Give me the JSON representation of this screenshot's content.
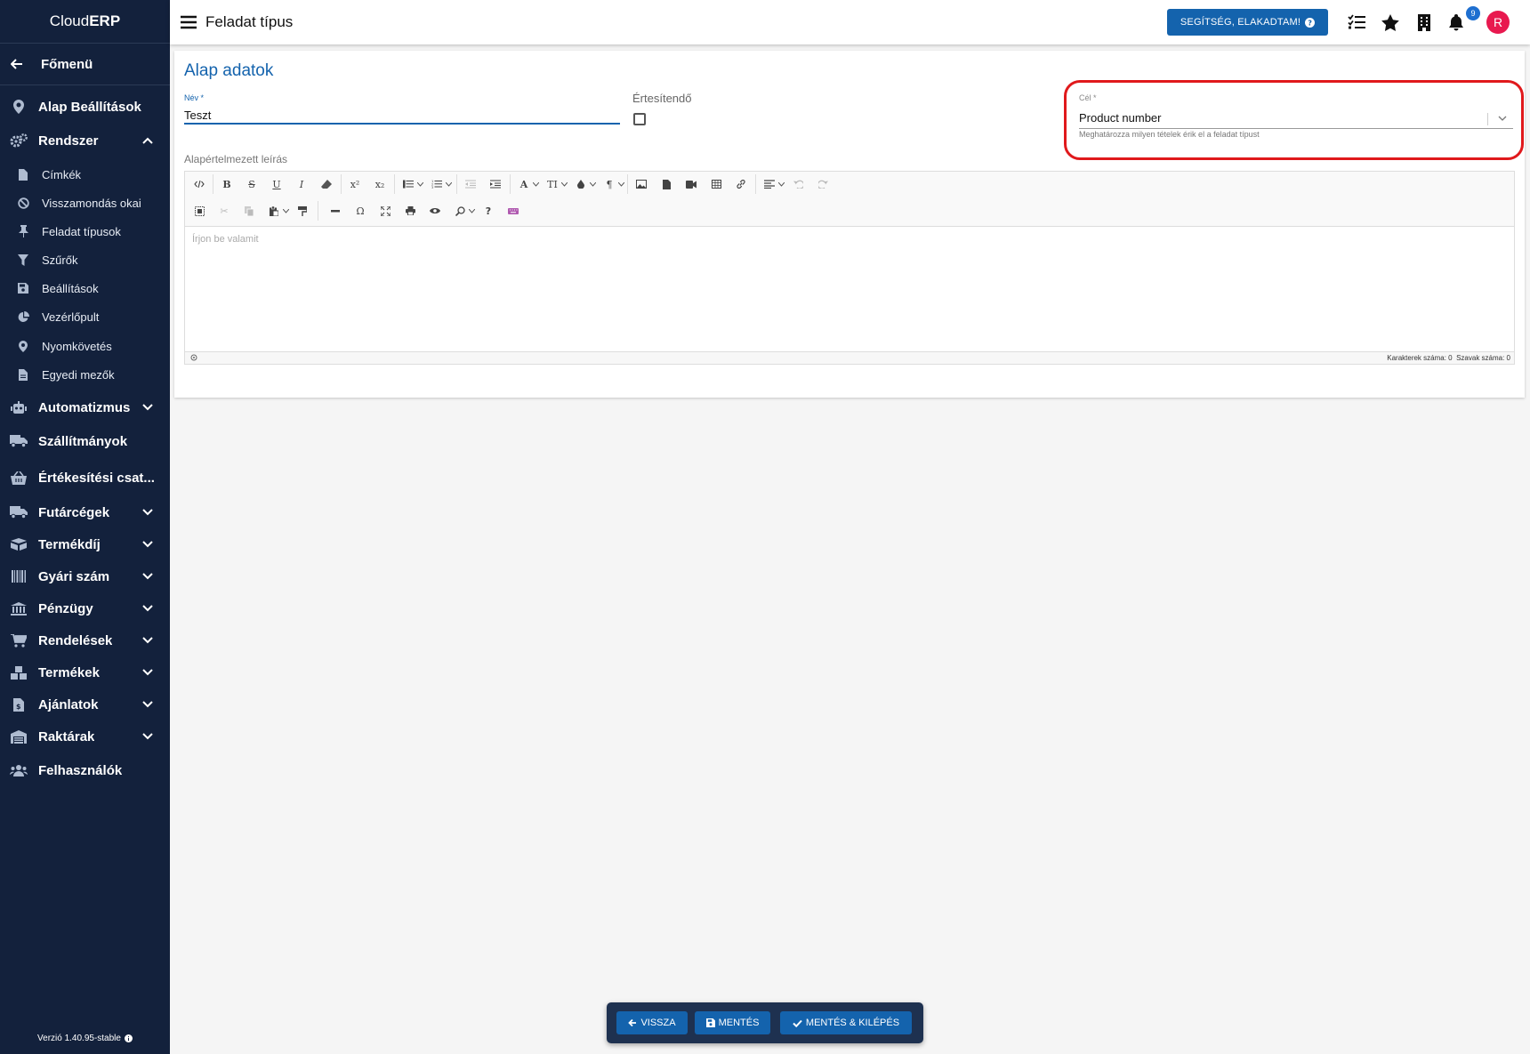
{
  "sidebar": {
    "brand_light": "Cloud",
    "brand_bold": "ERP",
    "back_label": "Főmenü",
    "version": "Verzió 1.40.95-stable",
    "items": [
      {
        "label": "Alap Beállítások",
        "icon": "pin-icon"
      },
      {
        "label": "Rendszer",
        "icon": "gears-icon",
        "expanded": true
      },
      {
        "label": "Automatizmus",
        "icon": "robot-icon"
      },
      {
        "label": "Szállítmányok",
        "icon": "truck-icon"
      },
      {
        "label": "Értékesítési csat...",
        "icon": "basket-icon"
      },
      {
        "label": "Futárcégek",
        "icon": "courier-truck-icon"
      },
      {
        "label": "Termékdíj",
        "icon": "boxes-icon"
      },
      {
        "label": "Gyári szám",
        "icon": "barcode-icon"
      },
      {
        "label": "Pénzügy",
        "icon": "bank-icon"
      },
      {
        "label": "Rendelések",
        "icon": "cart-icon"
      },
      {
        "label": "Termékek",
        "icon": "cubes-icon"
      },
      {
        "label": "Ajánlatok",
        "icon": "invoice-icon"
      },
      {
        "label": "Raktárak",
        "icon": "warehouse-icon"
      },
      {
        "label": "Felhasználók",
        "icon": "users-icon"
      }
    ],
    "subitems": [
      {
        "label": "Címkék",
        "icon": "file-icon"
      },
      {
        "label": "Visszamondás okai",
        "icon": "ban-icon"
      },
      {
        "label": "Feladat típusok",
        "icon": "thumbtack-icon"
      },
      {
        "label": "Szűrők",
        "icon": "filter-icon"
      },
      {
        "label": "Beállítások",
        "icon": "save-icon"
      },
      {
        "label": "Vezérlőpult",
        "icon": "pie-chart-icon"
      },
      {
        "label": "Nyomkövetés",
        "icon": "map-marker-icon"
      },
      {
        "label": "Egyedi mezők",
        "icon": "file-text-icon"
      }
    ]
  },
  "topbar": {
    "title": "Feladat típus",
    "help_button": "SEGÍTSÉG, ELAKADTAM!",
    "notification_count": "9",
    "avatar_initial": "R"
  },
  "form": {
    "section_title": "Alap adatok",
    "name_label": "Név *",
    "name_value": "Teszt",
    "notify_label": "Értesítendő",
    "notify_checked": false,
    "cel_label": "Cél *",
    "cel_value": "Product number",
    "cel_hint": "Meghatározza milyen tételek érik el a feladat típust",
    "desc_label": "Alapértelmezett leírás",
    "editor_placeholder": "Írjon be valamit",
    "char_count_label": "Karakterek száma: 0",
    "word_count_label": "Szavak száma: 0"
  },
  "actions": {
    "back": "VISSZA",
    "save": "MENTÉS",
    "save_exit": "MENTÉS & KILÉPÉS"
  },
  "colors": {
    "sidebar_bg": "#13213c",
    "accent": "#1463ad",
    "highlight": "#e0191c",
    "avatar": "#e8194f"
  }
}
